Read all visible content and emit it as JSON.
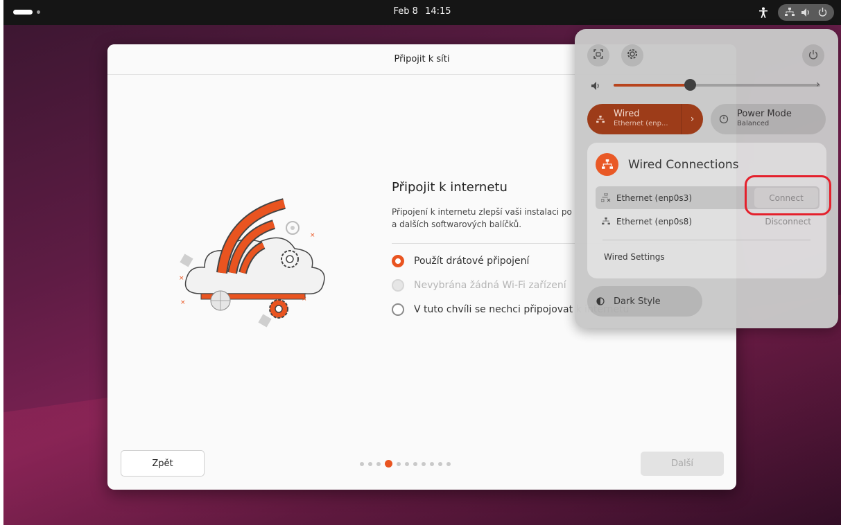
{
  "topbar": {
    "date": "Feb 8",
    "time": "14:15"
  },
  "installer": {
    "window_title": "Připojit k síti",
    "heading": "Připojit k internetu",
    "description": "Připojení k internetu zlepší vaši instalaci po a dalších softwarových balíčků.",
    "options": [
      {
        "label": "Použít drátové připojení",
        "state": "selected"
      },
      {
        "label": "Nevybrána žádná Wi-Fi zařízení",
        "state": "disabled"
      },
      {
        "label": "V tuto chvíli se nechci připojovat k internetu",
        "state": "unselected"
      }
    ],
    "back_label": "Zpět",
    "next_label": "Další",
    "pager": {
      "total": 11,
      "current": 4
    }
  },
  "quick_settings": {
    "volume_level": 0.37,
    "wired_tile": {
      "title": "Wired",
      "subtitle": "Ethernet (enp..."
    },
    "power_tile": {
      "title": "Power Mode",
      "subtitle": "Balanced"
    },
    "wired_menu": {
      "title": "Wired Connections",
      "connections": [
        {
          "name": "Ethernet (enp0s3)",
          "action": "Connect"
        },
        {
          "name": "Ethernet (enp0s8)",
          "action": "Disconnect"
        }
      ],
      "settings_label": "Wired Settings"
    },
    "dark_style_label": "Dark Style"
  },
  "colors": {
    "accent": "#e95420",
    "highlight": "#e4202c"
  }
}
